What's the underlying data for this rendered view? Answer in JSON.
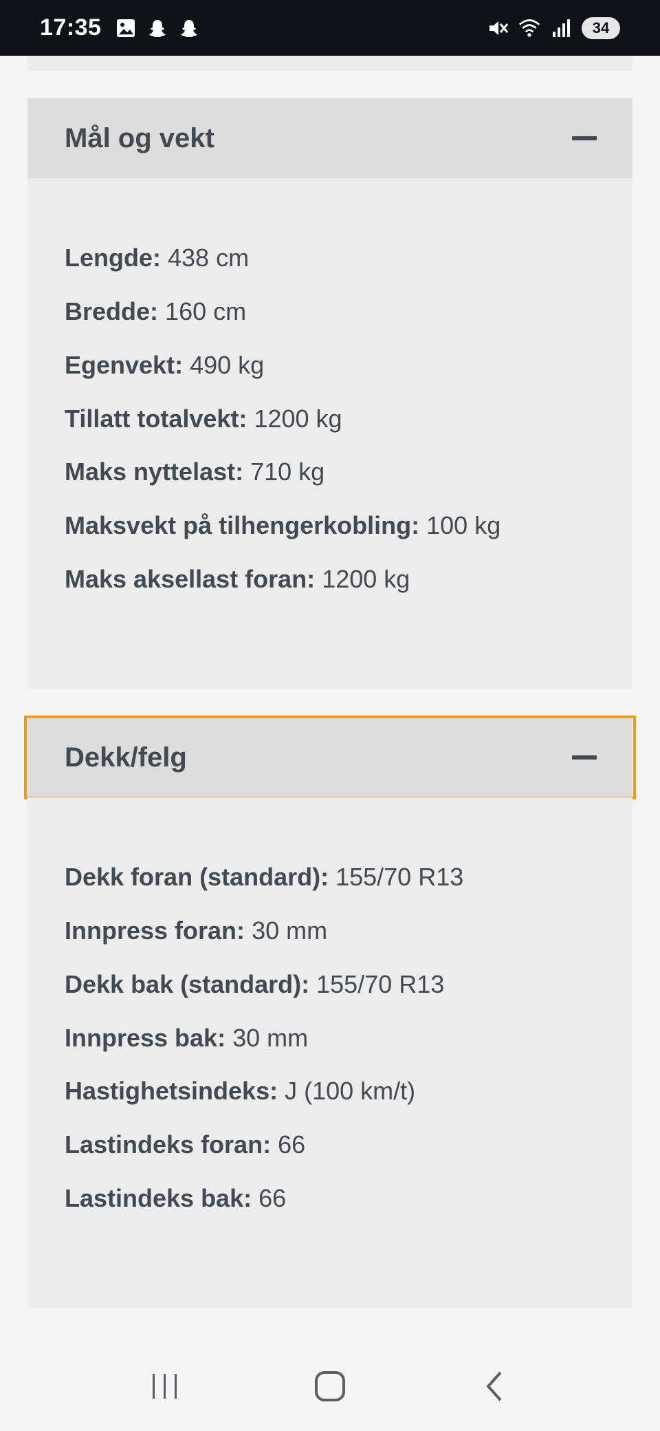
{
  "status_bar": {
    "time": "17:35",
    "left_icons": [
      "image-icon",
      "snapchat-icon",
      "snapchat-icon"
    ],
    "right_icons": [
      "mute-icon",
      "wifi-icon",
      "signal-icon"
    ],
    "battery": "34"
  },
  "sections": [
    {
      "title": "Mål og vekt",
      "rows": [
        {
          "label": "Lengde:",
          "value": "438 cm"
        },
        {
          "label": "Bredde:",
          "value": "160 cm"
        },
        {
          "label": "Egenvekt:",
          "value": "490 kg"
        },
        {
          "label": "Tillatt totalvekt:",
          "value": "1200 kg"
        },
        {
          "label": "Maks nyttelast:",
          "value": "710 kg"
        },
        {
          "label": "Maksvekt på tilhengerkobling:",
          "value": "100 kg"
        },
        {
          "label": "Maks aksellast foran:",
          "value": "1200 kg"
        }
      ]
    },
    {
      "title": "Dekk/felg",
      "rows": [
        {
          "label": "Dekk foran (standard):",
          "value": "155/70 R13"
        },
        {
          "label": "Innpress foran:",
          "value": "30 mm"
        },
        {
          "label": "Dekk bak (standard):",
          "value": "155/70 R13"
        },
        {
          "label": "Innpress bak:",
          "value": "30 mm"
        },
        {
          "label": "Hastighetsindeks:",
          "value": "J (100 km/t)"
        },
        {
          "label": "Lastindeks foran:",
          "value": "66"
        },
        {
          "label": "Lastindeks bak:",
          "value": "66"
        }
      ]
    }
  ],
  "colors": {
    "header_bg": "#dcdcdc",
    "body_bg": "#ececec",
    "text": "#414a52",
    "focus": "#f29a12"
  }
}
